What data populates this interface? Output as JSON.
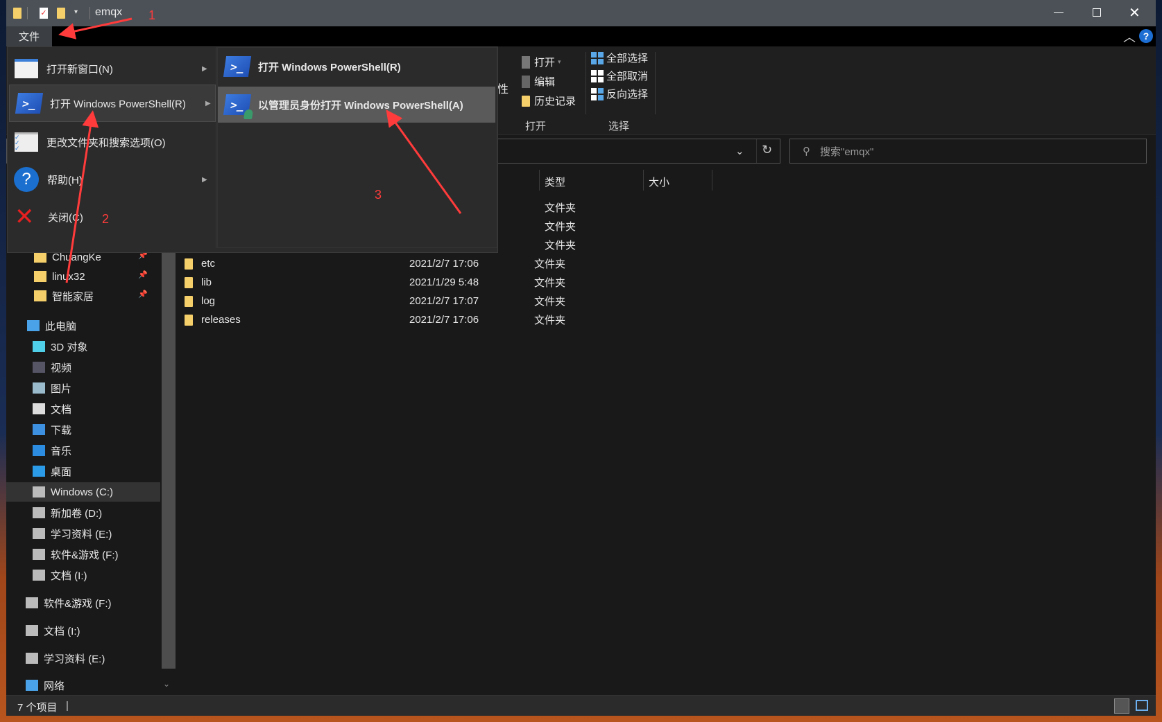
{
  "window": {
    "title": "emqx",
    "controls": {
      "minimize": "minimize-icon",
      "maximize": "maximize-icon",
      "close": "close-icon"
    }
  },
  "ribbon": {
    "file_tab": "文件",
    "partial_button": "性",
    "open_group": {
      "label": "打开",
      "items": [
        "打开",
        "编辑",
        "历史记录"
      ]
    },
    "select_group": {
      "label": "选择",
      "items": [
        "全部选择",
        "全部取消",
        "反向选择"
      ]
    }
  },
  "file_menu": {
    "items": [
      {
        "label": "打开新窗口(N)",
        "icon": "new-window-icon"
      },
      {
        "label": "打开 Windows PowerShell(R)",
        "icon": "powershell-icon"
      },
      {
        "label": "更改文件夹和搜索选项(O)",
        "icon": "options-icon"
      },
      {
        "label": "帮助(H)",
        "icon": "help-icon"
      },
      {
        "label": "关闭(C)",
        "icon": "close-red-icon"
      }
    ],
    "submenu": [
      {
        "label": "打开 Windows PowerShell(R)"
      },
      {
        "label": "以管理员身份打开 Windows PowerShell(A)"
      }
    ]
  },
  "search": {
    "placeholder": "搜索\"emqx\""
  },
  "columns": {
    "type": "类型",
    "size": "大小"
  },
  "files": [
    {
      "name": "",
      "date": "",
      "type": "文件夹"
    },
    {
      "name": "",
      "date": "",
      "type": "文件夹"
    },
    {
      "name": "",
      "date": "",
      "type": "文件夹"
    },
    {
      "name": "etc",
      "date": "2021/2/7 17:06",
      "type": "文件夹"
    },
    {
      "name": "lib",
      "date": "2021/1/29 5:48",
      "type": "文件夹"
    },
    {
      "name": "log",
      "date": "2021/2/7 17:07",
      "type": "文件夹"
    },
    {
      "name": "releases",
      "date": "2021/2/7 17:06",
      "type": "文件夹"
    }
  ],
  "sidebar": {
    "quick": [
      "ChuangKe",
      "linux32",
      "智能家居"
    ],
    "this_pc": "此电脑",
    "pc_items": [
      "3D 对象",
      "视频",
      "图片",
      "文档",
      "下载",
      "音乐",
      "桌面",
      "Windows (C:)",
      "新加卷 (D:)",
      "学习资料 (E:)",
      "软件&游戏 (F:)",
      "文档 (I:)"
    ],
    "drives": [
      "软件&游戏 (F:)",
      "文档 (I:)",
      "学习资料 (E:)"
    ],
    "network": "网络"
  },
  "status": {
    "count": "7 个项目"
  },
  "annotations": {
    "one": "1",
    "two": "2",
    "three": "3",
    "color": "#ff3b3b"
  }
}
